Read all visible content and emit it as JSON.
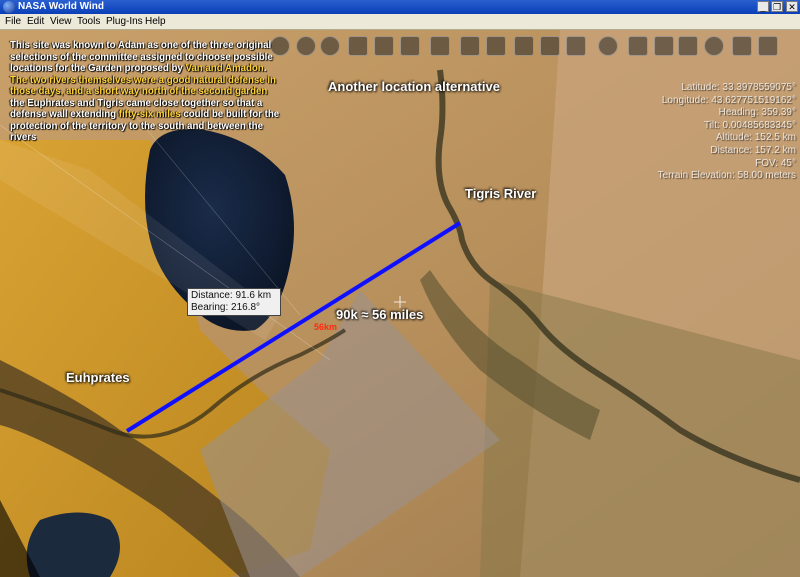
{
  "window": {
    "title": "NASA World Wind",
    "minimize_glyph": "_",
    "restore_glyph": "❐",
    "close_glyph": "✕"
  },
  "menu": {
    "items": [
      "File",
      "Edit",
      "View",
      "Tools",
      "Plug-Ins",
      "Help"
    ]
  },
  "caption": {
    "p1": "This site was known to Adam as one of the three original selections of the committee assigned to choose possible locations for the Garden proposed by ",
    "h1": "Van and Amadon",
    "p2": ". ",
    "h2": "The two rivers themselves were a good natural defense in those days, and a short way north of the second garden",
    "p3": " the Euphrates and Tigris came close together so that a defense wall extending ",
    "h3": "fifty-six miles",
    "p4": " could be built for the protection of the territory to the south and between the rivers"
  },
  "info_panel": {
    "latitude": "Latitude: 33.3978559075°",
    "longitude": "Longitude: 43.627751519162°",
    "heading": "Heading: 359.39°",
    "tilt": "Tilt: 0.00485683345°",
    "altitude": "Altitude: 152.5 km",
    "distance": "Distance: 157.2 km",
    "fov": "FOV: 45°",
    "terrain": "Terrain Elevation: 58.00 meters"
  },
  "map_labels": {
    "alternative": "Another location alternative",
    "tigris": "Tigris River",
    "euphrates": "Euhprates",
    "wall_length": "90k ≈ 56 miles",
    "small_km": "56km"
  },
  "measure_tool": {
    "distance": "Distance: 91.6 km",
    "bearing": "Bearing: 216.8°"
  },
  "colors": {
    "measure_line": "#1010ff",
    "highlight_text": "#ffd23a"
  }
}
